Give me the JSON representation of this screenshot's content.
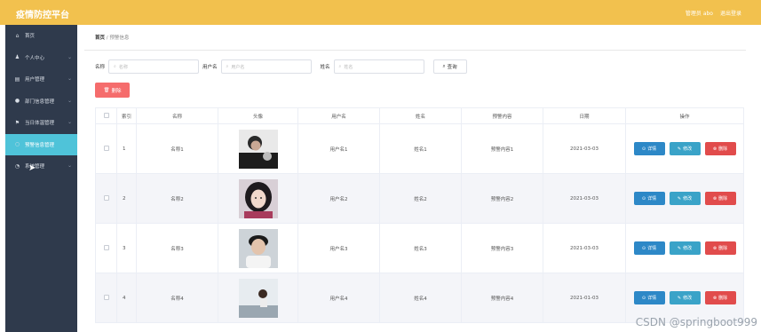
{
  "header": {
    "title": "疫情防控平台",
    "user_label": "管理员 abo",
    "logout_label": "退出登录"
  },
  "sidebar": {
    "items": [
      {
        "label": "首页",
        "icon": "home-icon",
        "glyph": "⌂",
        "chev": false,
        "active": false
      },
      {
        "label": "个人中心",
        "icon": "user-icon",
        "glyph": "♟",
        "chev": true,
        "active": false
      },
      {
        "label": "用户管理",
        "icon": "list-icon",
        "glyph": "▤",
        "chev": true,
        "active": false
      },
      {
        "label": "部门信息管理",
        "icon": "location-icon",
        "glyph": "●",
        "chev": true,
        "active": false
      },
      {
        "label": "当日体温管理",
        "icon": "flag-icon",
        "glyph": "⚑",
        "chev": true,
        "active": false
      },
      {
        "label": "预警信息管理",
        "icon": "search-icon",
        "glyph": "○",
        "chev": false,
        "active": true
      },
      {
        "label": "系统管理",
        "icon": "settings-icon",
        "glyph": "◔",
        "chev": true,
        "active": false
      }
    ]
  },
  "breadcrumb": {
    "home": "首页",
    "sep": "/",
    "current": "预警信息"
  },
  "search": {
    "name_label": "名称",
    "name_placeholder": "名称",
    "username_label": "用户名",
    "username_placeholder": "用户名",
    "realname_label": "姓名",
    "realname_placeholder": "姓名",
    "button": "查询"
  },
  "delete_button": "删除",
  "table": {
    "headers": [
      "",
      "索引",
      "名称",
      "头像",
      "用户名",
      "姓名",
      "预警内容",
      "日期",
      "操作"
    ],
    "rows": [
      {
        "index": "1",
        "name": "名称1",
        "username": "用户名1",
        "realname": "姓名1",
        "content": "预警内容1",
        "date": "2021-03-03"
      },
      {
        "index": "2",
        "name": "名称2",
        "username": "用户名2",
        "realname": "姓名2",
        "content": "预警内容2",
        "date": "2021-03-03"
      },
      {
        "index": "3",
        "name": "名称3",
        "username": "用户名3",
        "realname": "姓名3",
        "content": "预警内容3",
        "date": "2021-03-03"
      },
      {
        "index": "4",
        "name": "名称4",
        "username": "用户名4",
        "realname": "姓名4",
        "content": "预警内容4",
        "date": "2021-01-03"
      }
    ],
    "actions": {
      "detail": "详情",
      "edit": "修改",
      "remove": "删除"
    }
  },
  "watermark": "CSDN @springboot999",
  "colors": {
    "header": "#f2c14e",
    "sidebar": "#2f3a4c",
    "active": "#4fc3d9",
    "danger": "#f56c6c",
    "primary": "#2d88c7"
  }
}
